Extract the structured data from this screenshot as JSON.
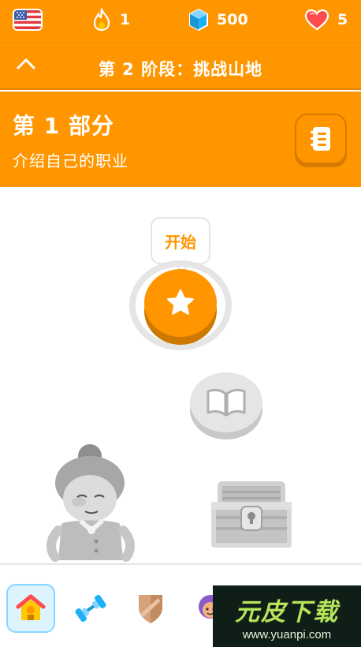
{
  "top_bar": {
    "language": "us-flag-icon",
    "streak": "1",
    "gems": "500",
    "hearts": "5"
  },
  "stage": {
    "title": "第 2 阶段：挑战山地"
  },
  "unit": {
    "title": "第 1 部分",
    "subtitle": "介绍自己的职业"
  },
  "path": {
    "start_tooltip": "开始"
  },
  "tabs": [
    "home-icon",
    "practice-dumbbell-icon",
    "leagues-shield-icon",
    "profile-avatar-icon"
  ],
  "watermark": {
    "main": "元皮下载",
    "url": "www.yuanpi.com"
  },
  "colors": {
    "accent": "#ff9600",
    "accent_dark": "#cd7900",
    "locked": "#e5e5e5",
    "gem": "#1cb0f6",
    "heart": "#ff4b4b"
  }
}
